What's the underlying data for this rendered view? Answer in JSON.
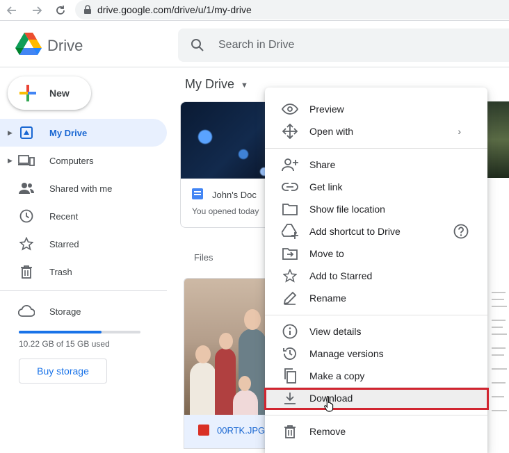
{
  "browser": {
    "url": "drive.google.com/drive/u/1/my-drive"
  },
  "header": {
    "brand": "Drive",
    "search_placeholder": "Search in Drive"
  },
  "sidebar": {
    "new_label": "New",
    "items": [
      {
        "label": "My Drive",
        "icon": "my-drive-icon",
        "active": true
      },
      {
        "label": "Computers",
        "icon": "computers-icon"
      },
      {
        "label": "Shared with me",
        "icon": "shared-icon"
      },
      {
        "label": "Recent",
        "icon": "clock-icon"
      },
      {
        "label": "Starred",
        "icon": "star-icon"
      },
      {
        "label": "Trash",
        "icon": "trash-icon"
      }
    ],
    "storage_label": "Storage",
    "storage_used": "10.22 GB of 15 GB used",
    "storage_fraction": 0.68,
    "buy_label": "Buy storage"
  },
  "main": {
    "breadcrumb": "My Drive",
    "suggested_card": {
      "name": "John's Doc",
      "subtitle": "You opened today"
    },
    "files_label": "Files",
    "photo_file": "00RTK.JPG"
  },
  "context_menu": {
    "groups": [
      [
        {
          "label": "Preview",
          "icon": "eye-icon"
        },
        {
          "label": "Open with",
          "icon": "move-arrows-icon",
          "submenu": true
        }
      ],
      [
        {
          "label": "Share",
          "icon": "add-person-icon"
        },
        {
          "label": "Get link",
          "icon": "link-icon"
        },
        {
          "label": "Show file location",
          "icon": "folder-icon"
        },
        {
          "label": "Add shortcut to Drive",
          "icon": "add-shortcut-icon",
          "help": true
        },
        {
          "label": "Move to",
          "icon": "move-to-icon"
        },
        {
          "label": "Add to Starred",
          "icon": "star-outline-icon"
        },
        {
          "label": "Rename",
          "icon": "pencil-icon"
        }
      ],
      [
        {
          "label": "View details",
          "icon": "info-icon"
        },
        {
          "label": "Manage versions",
          "icon": "history-icon"
        },
        {
          "label": "Make a copy",
          "icon": "copy-icon"
        },
        {
          "label": "Download",
          "icon": "download-icon",
          "highlighted": true
        }
      ],
      [
        {
          "label": "Remove",
          "icon": "trash-icon"
        }
      ]
    ]
  },
  "colors": {
    "accent": "#1a73e8",
    "active_bg": "#e8f0fe",
    "highlight_border": "#d12530"
  }
}
